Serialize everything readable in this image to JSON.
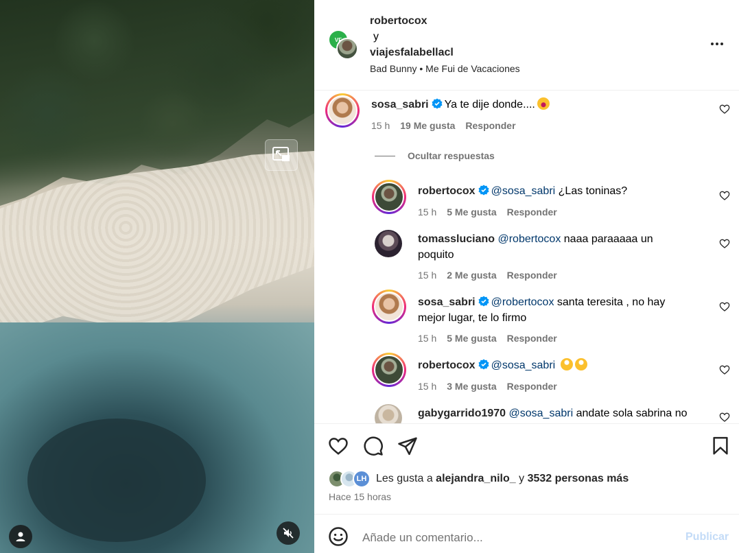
{
  "header": {
    "owner1": "robertocox",
    "joiner": "y",
    "owner2": "viajesfalabellacl",
    "music": "Bad Bunny • Me Fui de Vacaciones",
    "brand_avatar_text": "VF"
  },
  "comments": {
    "main": {
      "user": "sosa_sabri",
      "text": "Ya te dije donde....",
      "time": "15 h",
      "likes": "19 Me gusta",
      "reply": "Responder"
    },
    "hide_replies": "Ocultar respuestas",
    "replies": [
      {
        "user": "robertocox",
        "mention": "@sosa_sabri",
        "text": " ¿Las toninas?",
        "time": "15 h",
        "likes": "5 Me gusta",
        "reply": "Responder"
      },
      {
        "user": "tomassluciano",
        "mention": "@robertocox",
        "text": " naaa paraaaaa un",
        "text2": "poquito",
        "time": "15 h",
        "likes": "2 Me gusta",
        "reply": "Responder"
      },
      {
        "user": "sosa_sabri",
        "mention": "@robertocox",
        "text": " santa teresita , no hay",
        "text2": "mejor lugar, te lo firmo",
        "time": "15 h",
        "likes": "5 Me gusta",
        "reply": "Responder"
      },
      {
        "user": "robertocox",
        "mention": "@sosa_sabri",
        "text": " ",
        "time": "15 h",
        "likes": "3 Me gusta",
        "reply": "Responder"
      },
      {
        "user": "gabygarrido1970",
        "mention": "@sosa_sabri",
        "text": " andate sola sabrina no"
      }
    ]
  },
  "likes": {
    "prefix": "Les gusta a ",
    "user": "alejandra_nilo_",
    "middle": " y ",
    "others": "3532 personas más",
    "avatar_initials": "LH"
  },
  "posted": "Hace 15 horas",
  "composer": {
    "placeholder": "Añade un comentario...",
    "publish": "Publicar"
  },
  "colors": {
    "link": "#00376b",
    "verified": "#0095f6",
    "muted": "#737373",
    "publish_disabled": "#c3dbf7"
  },
  "icons": [
    "pip-icon",
    "user-tag-icon",
    "mute-icon",
    "more-icon",
    "verified-icon",
    "heart-icon",
    "comment-icon",
    "share-icon",
    "save-icon",
    "smile-icon"
  ]
}
